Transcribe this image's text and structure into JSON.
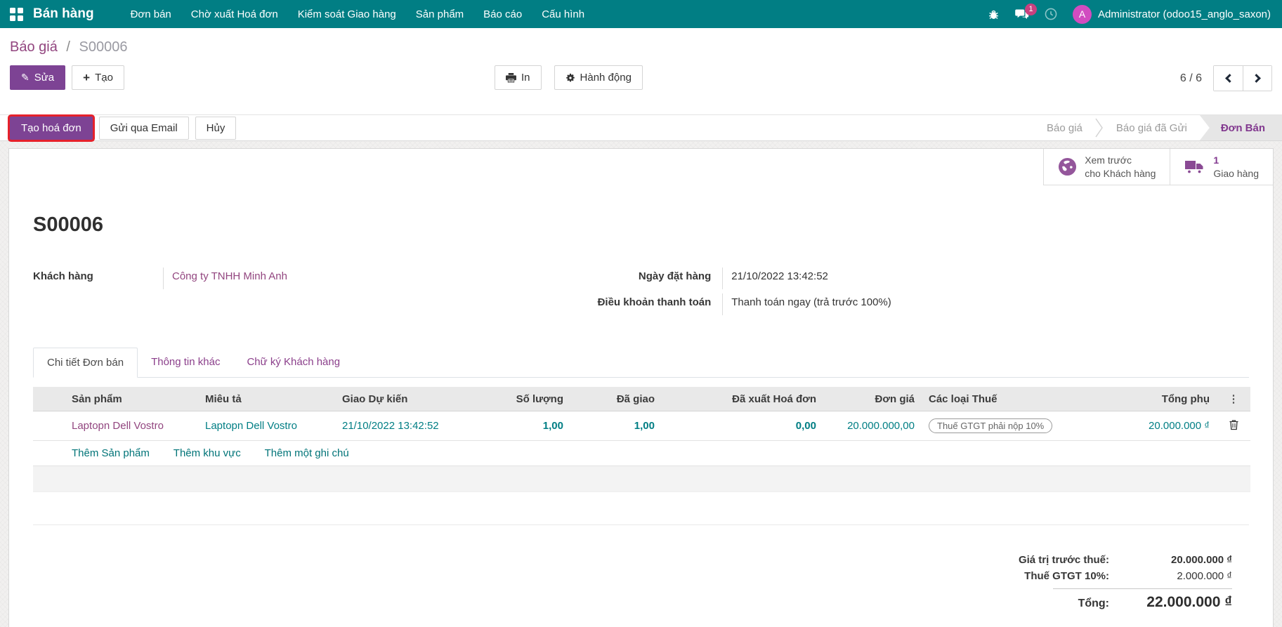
{
  "nav": {
    "app_name": "Bán hàng",
    "items": [
      "Đơn bán",
      "Chờ xuất Hoá đơn",
      "Kiểm soát Giao hàng",
      "Sản phẩm",
      "Báo cáo",
      "Cấu hình"
    ],
    "message_badge": "1",
    "user_initial": "A",
    "user_name": "Administrator (odoo15_anglo_saxon)"
  },
  "breadcrumb": {
    "parent": "Báo giá",
    "separator": "/",
    "current": "S00006"
  },
  "control": {
    "edit_label": "Sửa",
    "create_label": "Tạo",
    "print_label": "In",
    "action_label": "Hành động",
    "pager_text": "6 / 6"
  },
  "statusbar": {
    "create_invoice_label": "Tạo hoá đơn",
    "send_email_label": "Gửi qua Email",
    "cancel_label": "Hủy",
    "pipeline": [
      {
        "label": "Báo giá"
      },
      {
        "label": "Báo giá đã Gửi"
      },
      {
        "label": "Đơn Bán"
      }
    ]
  },
  "smart_buttons": {
    "preview_line1": "Xem trước",
    "preview_line2": "cho Khách hàng",
    "delivery_count": "1",
    "delivery_label": "Giao hàng"
  },
  "form": {
    "title": "S00006",
    "customer_label": "Khách hàng",
    "customer_value": "Công ty TNHH Minh Anh",
    "order_date_label": "Ngày đặt hàng",
    "order_date_value": "21/10/2022 13:42:52",
    "payment_terms_label": "Điều khoản thanh toán",
    "payment_terms_value": "Thanh toán ngay (trả trước 100%)"
  },
  "tabs": [
    {
      "label": "Chi tiết Đơn bán"
    },
    {
      "label": "Thông tin khác"
    },
    {
      "label": "Chữ ký Khách hàng"
    }
  ],
  "table": {
    "headers": [
      "",
      "Sản phẩm",
      "Miêu tả",
      "Giao Dự kiến",
      "Số lượng",
      "Đã giao",
      "Đã xuất Hoá đơn",
      "Đơn giá",
      "Các loại Thuế",
      "Tổng phụ"
    ],
    "row": {
      "product": "Laptopn Dell Vostro",
      "description": "Laptopn Dell Vostro",
      "expected_delivery": "21/10/2022 13:42:52",
      "quantity": "1,00",
      "delivered": "1,00",
      "invoiced": "0,00",
      "unit_price": "20.000.000,00",
      "taxes": "Thuế GTGT phải nộp 10%",
      "subtotal": "20.000.000 ₫"
    },
    "add_links": [
      "Thêm Sản phẩm",
      "Thêm khu vực",
      "Thêm một ghi chú"
    ]
  },
  "totals": {
    "untaxed_label": "Giá trị trước thuế:",
    "untaxed_value": "20.000.000 ₫",
    "tax_label": "Thuế GTGT 10%:",
    "tax_value": "2.000.000 ₫",
    "total_label": "Tổng:",
    "total_value": "22.000.000 ₫"
  },
  "colors": {
    "navbar_teal": "#017e84",
    "accent_purple": "#7d4394",
    "link_purple": "#92457f",
    "teal_text": "#017e84",
    "highlight_red": "#e6212b",
    "avatar_magenta": "#d14cc0"
  },
  "icons": {
    "apps": "grid-icon",
    "bug": "bug-icon",
    "messages": "chat-bubbles-icon",
    "activities": "clock-icon",
    "preview": "globe-icon",
    "delivery": "truck-icon",
    "print": "printer-icon",
    "action": "gear-icon",
    "delete": "trash-icon",
    "optional_columns": "vertical-dots-icon"
  }
}
